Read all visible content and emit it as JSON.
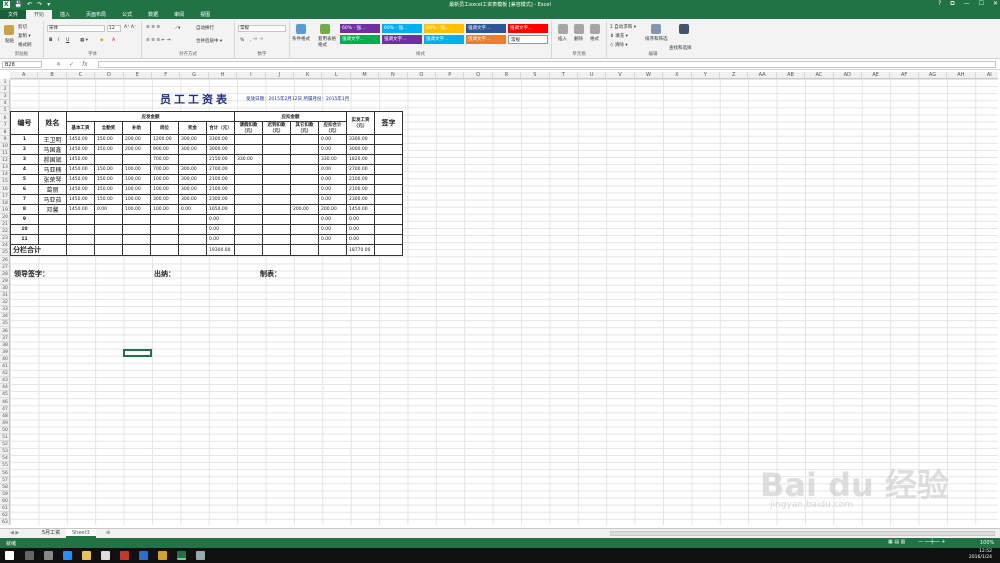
{
  "window": {
    "title": "最新员工excel工资表模板 [兼容模式] - Excel",
    "controls": [
      "?",
      "⧉",
      "—",
      "☐",
      "✕"
    ]
  },
  "quick_access": [
    "💾",
    "↶",
    "↷",
    "▾"
  ],
  "tabs": [
    "文件",
    "开始",
    "插入",
    "页面布局",
    "公式",
    "数据",
    "审阅",
    "视图"
  ],
  "ribbon": {
    "clipboard": {
      "label": "剪贴板",
      "cut": "剪切",
      "copy": "复制 ▾",
      "painter": "格式刷",
      "paste": "粘贴"
    },
    "font": {
      "label": "字体",
      "name": "宋体",
      "size": "12",
      "bold": "B",
      "italic": "I",
      "underline": "U"
    },
    "alignment": {
      "label": "对齐方式",
      "wrap": "自动换行",
      "merge": "合并后居中 ▾"
    },
    "number": {
      "label": "数字",
      "format": "常规",
      "percent": "%"
    },
    "styles": {
      "label": "样式",
      "cond": "条件格式",
      "table": "套用表格格式",
      "items": [
        {
          "text": "60% - 强...",
          "color": "#7030a0"
        },
        {
          "text": "60% - 强...",
          "color": "#00b0f0"
        },
        {
          "text": "60% - 强...",
          "color": "#ffc000"
        },
        {
          "text": "强调文字...",
          "color": "#2f5597"
        },
        {
          "text": "强调文字...",
          "color": "#ff0000"
        },
        {
          "text": "强调文字...",
          "color": "#00b050"
        },
        {
          "text": "强调文字...",
          "color": "#7030a0"
        },
        {
          "text": "强调文字...",
          "color": "#00b0f0"
        },
        {
          "text": "强调文字...",
          "color": "#ed7d31"
        },
        {
          "text": "常规",
          "color": "#ffffff"
        }
      ]
    },
    "cells": {
      "label": "单元格",
      "insert": "插入",
      "delete": "删除",
      "format": "格式"
    },
    "editing": {
      "label": "编辑",
      "autosum": "自动求和 ▾",
      "fill": "填充 ▾",
      "clear": "清除 ▾",
      "sort": "排序和筛选",
      "find": "查找和选择"
    }
  },
  "formula_bar": {
    "name_box": "B28",
    "buttons": [
      "✕",
      "✓",
      "fx"
    ],
    "value": ""
  },
  "columns": [
    "A",
    "B",
    "C",
    "D",
    "E",
    "F",
    "G",
    "H",
    "I",
    "J",
    "K",
    "L",
    "M",
    "N",
    "O",
    "P",
    "Q",
    "R",
    "S",
    "T",
    "U",
    "V",
    "W",
    "X",
    "Y",
    "Z",
    "AA",
    "AB",
    "AC",
    "AD",
    "AE",
    "AF",
    "AG",
    "AH",
    "AI",
    "AJ"
  ],
  "sheet": {
    "title": "员工工资表",
    "subtitle": "发放日期：2015年2月12日  所属月份：2015年1月",
    "group_headers": {
      "should": "应发金额",
      "deduct": "应扣金额"
    },
    "headers": {
      "no": "编号",
      "name": "姓名",
      "base": "基本工资",
      "attend": "全勤奖",
      "subsidy": "补助",
      "post": "岗位",
      "bonus": "奖金",
      "total": "合计（元）",
      "leave": "请假扣款（元）",
      "late": "迟到扣款（元）",
      "other": "其它扣款（元）",
      "deduct_total": "应扣合计（元）",
      "net": "实发工资（元）",
      "sign": "签字"
    },
    "rows": [
      {
        "no": "1",
        "name": "王卫明",
        "base": "1450.00",
        "attend": "150.00",
        "subsidy": "200.00",
        "post": "1200.00",
        "bonus": "300.00",
        "total": "3300.00",
        "leave": "",
        "late": "",
        "other": "",
        "dt": "0.00",
        "net": "3300.00"
      },
      {
        "no": "2",
        "name": "马国鑫",
        "base": "1450.00",
        "attend": "150.00",
        "subsidy": "200.00",
        "post": "900.00",
        "bonus": "300.00",
        "total": "3000.00",
        "leave": "",
        "late": "",
        "other": "",
        "dt": "0.00",
        "net": "3000.00"
      },
      {
        "no": "3",
        "name": "郝国斌",
        "base": "1450.00",
        "attend": "",
        "subsidy": "",
        "post": "700.00",
        "bonus": "",
        "total": "2150.00",
        "leave": "330.00",
        "late": "",
        "other": "",
        "dt": "330.00",
        "net": "1820.00"
      },
      {
        "no": "4",
        "name": "马亚楠",
        "base": "1450.00",
        "attend": "150.00",
        "subsidy": "100.00",
        "post": "700.00",
        "bonus": "300.00",
        "total": "2700.00",
        "leave": "",
        "late": "",
        "other": "",
        "dt": "0.00",
        "net": "2700.00"
      },
      {
        "no": "5",
        "name": "张荣琴",
        "base": "1450.00",
        "attend": "150.00",
        "subsidy": "100.00",
        "post": "100.00",
        "bonus": "300.00",
        "total": "2100.00",
        "leave": "",
        "late": "",
        "other": "",
        "dt": "0.00",
        "net": "2100.00"
      },
      {
        "no": "6",
        "name": "葛丽",
        "base": "1450.00",
        "attend": "150.00",
        "subsidy": "100.00",
        "post": "100.00",
        "bonus": "300.00",
        "total": "2100.00",
        "leave": "",
        "late": "",
        "other": "",
        "dt": "0.00",
        "net": "2100.00"
      },
      {
        "no": "7",
        "name": "马亚茹",
        "base": "1450.00",
        "attend": "150.00",
        "subsidy": "100.00",
        "post": "300.00",
        "bonus": "300.00",
        "total": "2300.00",
        "leave": "",
        "late": "",
        "other": "",
        "dt": "0.00",
        "net": "2300.00"
      },
      {
        "no": "8",
        "name": "邓馨",
        "base": "1450.00",
        "attend": "0.00",
        "subsidy": "100.00",
        "post": "100.00",
        "bonus": "0.00",
        "total": "1650.00",
        "leave": "",
        "late": "",
        "other": "200.00",
        "dt": "200.00",
        "net": "1450.00"
      },
      {
        "no": "9",
        "name": "",
        "base": "",
        "attend": "",
        "subsidy": "",
        "post": "",
        "bonus": "",
        "total": "0.00",
        "leave": "",
        "late": "",
        "other": "",
        "dt": "0.00",
        "net": "0.00"
      },
      {
        "no": "10",
        "name": "",
        "base": "",
        "attend": "",
        "subsidy": "",
        "post": "",
        "bonus": "",
        "total": "0.00",
        "leave": "",
        "late": "",
        "other": "",
        "dt": "0.00",
        "net": "0.00"
      },
      {
        "no": "11",
        "name": "",
        "base": "",
        "attend": "",
        "subsidy": "",
        "post": "",
        "bonus": "",
        "total": "0.00",
        "leave": "",
        "late": "",
        "other": "",
        "dt": "0.00",
        "net": "0.00"
      }
    ],
    "summary": {
      "label": "分栏合计",
      "total": "19300.00",
      "net": "18770.00"
    },
    "sign": {
      "leader": "领导签字：",
      "cashier": "出纳：",
      "maker": "制表："
    }
  },
  "sheet_tabs": [
    "5月工资",
    "Sheet3"
  ],
  "status": {
    "left": "就绪",
    "zoom": "100%"
  },
  "clock": {
    "time": "12:52",
    "date": "2016/1/24"
  },
  "watermark": {
    "logo": "Bai du 经验",
    "url": "jingyan.baidu.com"
  }
}
